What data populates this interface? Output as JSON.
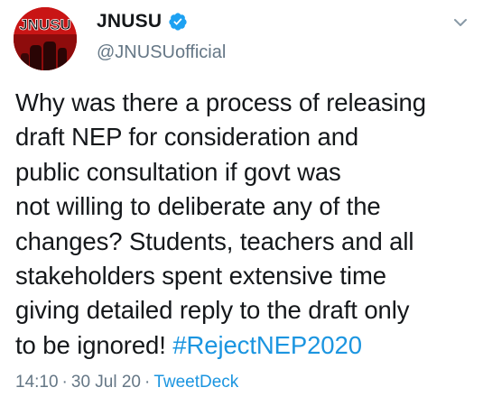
{
  "tweet": {
    "avatar_text": "JNUSU",
    "display_name": "JNUSU",
    "handle": "@JNUSUofficial",
    "body_lines": [
      "Why was there a process of releasing",
      "draft NEP for consideration and",
      "public consultation if govt was",
      "not willing to deliberate any of the",
      "changes? Students, teachers and all",
      "stakeholders spent extensive time",
      "giving detailed reply to the draft only",
      "to be ignored! "
    ],
    "hashtag": "#RejectNEP2020",
    "time": "14:10",
    "date": "30 Jul 20",
    "source": "TweetDeck",
    "separator": "·"
  },
  "icons": {
    "verified": "verified-badge-icon",
    "more": "chevron-down-icon"
  },
  "colors": {
    "text": "#14171a",
    "secondary": "#657786",
    "link": "#1b95e0",
    "verified": "#1da1f2",
    "avatar_bg": "#c91515"
  }
}
